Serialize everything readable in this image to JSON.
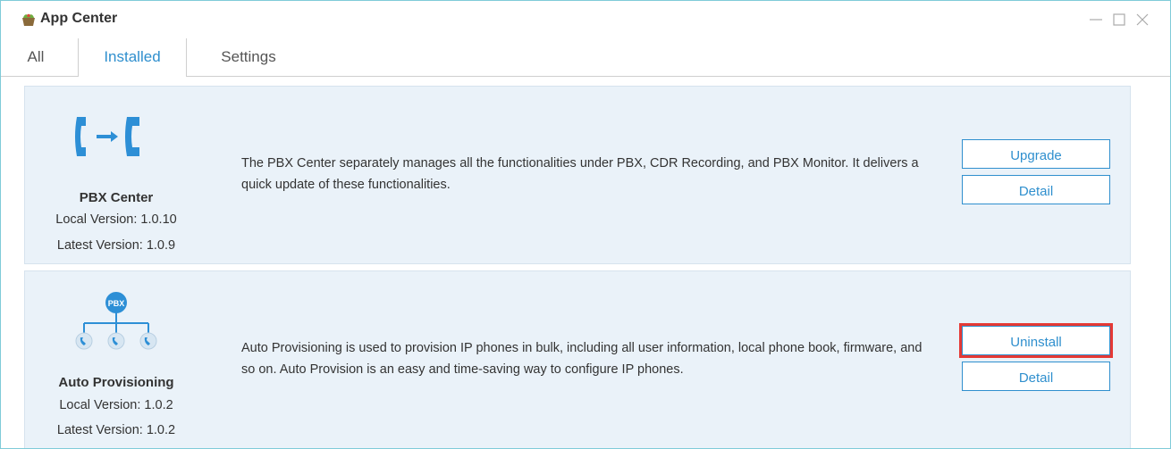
{
  "window": {
    "title": "App Center",
    "controls": [
      "minimize",
      "maximize",
      "close"
    ]
  },
  "tabs": [
    {
      "label": "All",
      "active": false
    },
    {
      "label": "Installed",
      "active": true
    },
    {
      "label": "Settings",
      "active": false
    }
  ],
  "apps": [
    {
      "name": "PBX Center",
      "local_version": "Local Version: 1.0.10",
      "latest_version": "Latest Version: 1.0.9",
      "description": "The PBX Center separately manages all the functionalities under PBX, CDR Recording, and PBX Monitor. It delivers a quick update of these functionalities.",
      "primary_button": "Upgrade",
      "detail_button": "Detail",
      "icon": "phone-transfer-icon"
    },
    {
      "name": "Auto Provisioning",
      "local_version": "Local Version: 1.0.2",
      "latest_version": "Latest Version: 1.0.2",
      "description": "Auto Provisioning is used to provision IP phones in bulk, including all user information, local phone book, firmware, and so on. Auto Provision is an easy and time-saving way to configure IP phones.",
      "primary_button": "Uninstall",
      "detail_button": "Detail",
      "icon": "pbx-tree-icon",
      "icon_label": "PBX"
    }
  ],
  "colors": {
    "accent": "#2f8fce",
    "card_bg": "#eaf2f9",
    "highlight": "#e53935",
    "window_border": "#7fcbd9"
  }
}
